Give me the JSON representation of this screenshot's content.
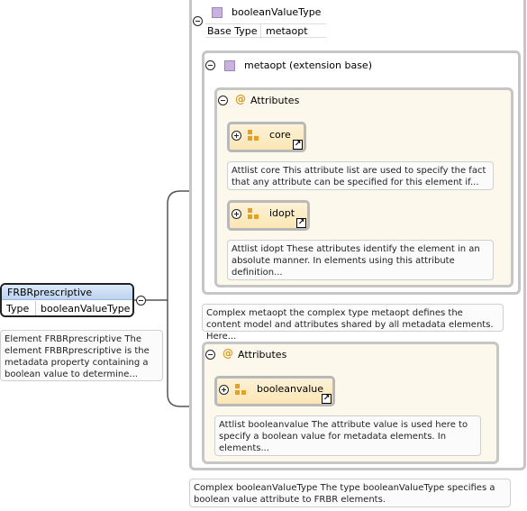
{
  "complex_type": {
    "name": "booleanValueType",
    "base_type_label": "Base Type",
    "base_type_value": "metaopt",
    "description": "Complex booleanValueType The type booleanValueType specifies a boolean value attribute to FRBR elements."
  },
  "extension": {
    "title": "metaopt (extension base)",
    "description": "Complex metaopt the complex type metaopt defines the content model and attributes shared by all metadata elements. Here...",
    "attributes_title": "Attributes",
    "attributes": [
      {
        "name": "core",
        "description": "Attlist core This attribute list are used to specify the fact that any attribute can be specified for this element if..."
      },
      {
        "name": "idopt",
        "description": "Attlist idopt These attributes identify the element in an absolute manner. In elements using this attribute definition..."
      }
    ]
  },
  "own_attributes": {
    "title": "Attributes",
    "attributes": [
      {
        "name": "booleanvalue",
        "description": "Attlist booleanvalue The attribute value is used here to specify a boolean value for metadata elements. In elements..."
      }
    ]
  },
  "element": {
    "name": "FRBRprescriptive",
    "type_label": "Type",
    "type_value": "booleanValueType",
    "description": "Element FRBRprescriptive The element FRBRprescriptive is the metadata property containing a boolean value to determine..."
  },
  "colors": {
    "header_blue": "#c7dcf5",
    "attr_fill": "#fbe6b4",
    "group_fill": "#fdf8ec",
    "connector": "#555555"
  }
}
